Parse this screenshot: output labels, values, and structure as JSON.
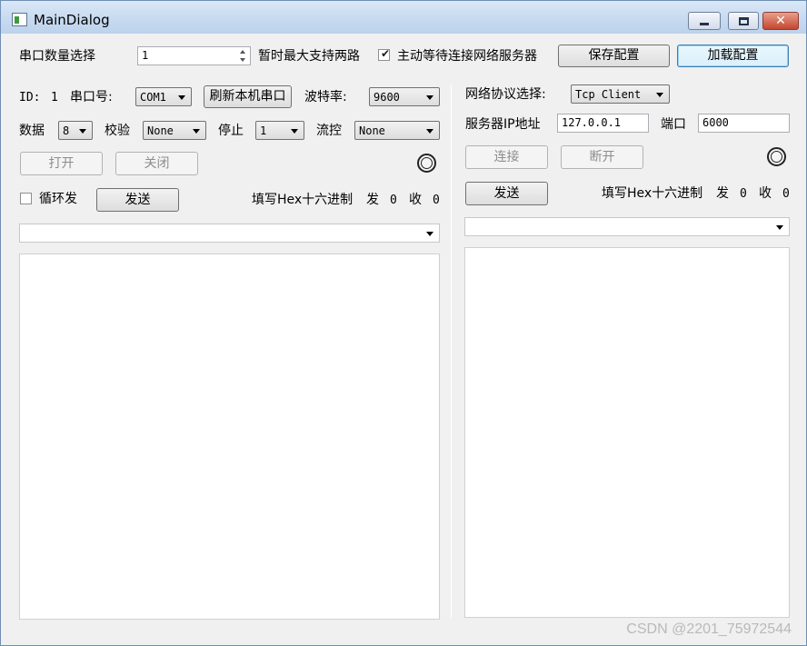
{
  "window": {
    "title": "MainDialog"
  },
  "top": {
    "port_count_label": "串口数量选择",
    "port_count_value": "1",
    "max_note": "暂时最大支持两路",
    "auto_wait_label": "主动等待连接网络服务器",
    "auto_wait_checked": true,
    "save_button": "保存配置",
    "load_button": "加载配置"
  },
  "serial": {
    "id_label": "ID:",
    "id_value": "1",
    "port_label": "串口号:",
    "port_value": "COM1",
    "refresh_button": "刷新本机串口",
    "baud_label": "波特率:",
    "baud_value": "9600",
    "data_label": "数据",
    "data_value": "8",
    "parity_label": "校验",
    "parity_value": "None",
    "stop_label": "停止",
    "stop_value": "1",
    "flow_label": "流控",
    "flow_value": "None",
    "open_button": "打开",
    "close_button": "关闭",
    "loop_label": "循环发",
    "send_button": "发送",
    "hex_label": "填写Hex十六进制",
    "sent_label": "发",
    "sent_count": "0",
    "recv_label": "收",
    "recv_count": "0"
  },
  "network": {
    "protocol_label": "网络协议选择:",
    "protocol_value": "Tcp Client",
    "server_ip_label": "服务器IP地址",
    "server_ip_value": "127.0.0.1",
    "port_label": "端口",
    "port_value": "6000",
    "connect_button": "连接",
    "disconnect_button": "断开",
    "send_button": "发送",
    "hex_label": "填写Hex十六进制",
    "sent_label": "发",
    "sent_count": "0",
    "recv_label": "收",
    "recv_count": "0"
  },
  "watermark": "CSDN @2201_75972544"
}
